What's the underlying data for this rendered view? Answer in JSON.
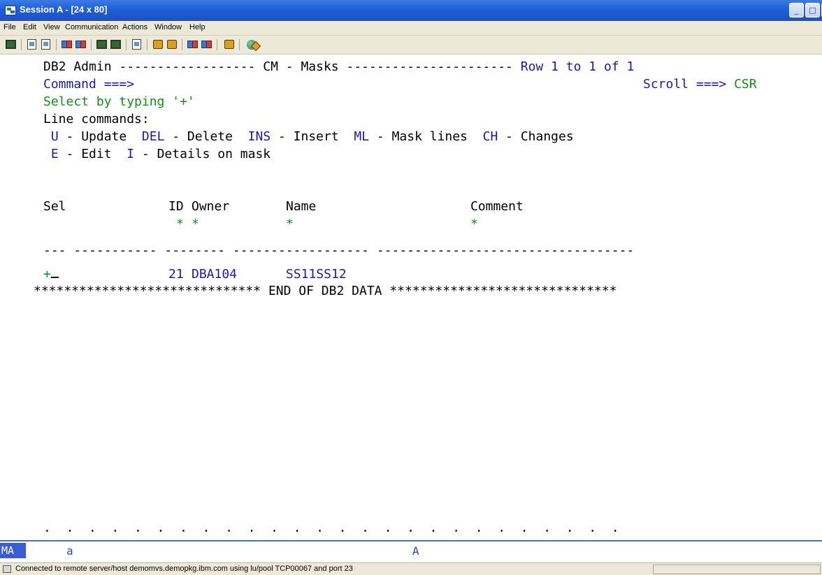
{
  "window": {
    "title": "Session A - [24 x 80]",
    "controls": {
      "minimize": "_",
      "maximize": "□",
      "close": "×"
    }
  },
  "menu": [
    {
      "label": "File"
    },
    {
      "label": "Edit"
    },
    {
      "label": "View"
    },
    {
      "label": "Communication"
    },
    {
      "label": "Actions"
    },
    {
      "label": "Window"
    },
    {
      "label": "Help"
    }
  ],
  "toolbar": {
    "icons": [
      "print-screen-icon",
      "copy-icon",
      "paste-icon",
      "send-file-icon",
      "receive-file-icon",
      "display-icon",
      "display-alt-icon",
      "keypad-icon",
      "record-macro-icon",
      "play-macro-icon",
      "stop-macro-icon",
      "macro-options-icon",
      "clipboard-icon",
      "globe-icon"
    ]
  },
  "terminal": {
    "header_left": "DB2 Admin ------------------ CM - Masks ----------------------",
    "header_right": "Row 1 to 1 of 1",
    "command_label": "Command ===>",
    "scroll_label": "Scroll ===>",
    "scroll_value": "CSR",
    "select_hint": "Select by typing '+'",
    "line_commands_label": "Line commands:",
    "line_commands_row1": [
      {
        "key": "U",
        "desc": " - Update  "
      },
      {
        "key": "DEL",
        "desc": " - Delete  "
      },
      {
        "key": "INS",
        "desc": " - Insert  "
      },
      {
        "key": "ML",
        "desc": " - Mask lines  "
      },
      {
        "key": "CH",
        "desc": " - Changes"
      }
    ],
    "line_commands_row2": [
      {
        "key": "E",
        "desc": " - Edit  "
      },
      {
        "key": "I",
        "desc": " - Details on mask"
      }
    ],
    "columns": {
      "sel": "Sel",
      "id": "ID",
      "owner": "Owner",
      "name": "Name",
      "comment": "Comment"
    },
    "filters": {
      "id": "*",
      "owner": "*",
      "name": "*",
      "comment": "*"
    },
    "separator": "--- ----------- -------- ------------------ ----------------------------------",
    "rows": [
      {
        "sel": "+",
        "id": "21",
        "owner": "DBA104",
        "name": "SS11SS12",
        "comment": ""
      }
    ],
    "end_line": "****************************** END OF DB2 DATA ******************************",
    "bottom_dots": ".  .  .  .  .  .  .  .  .  .  .  .  .  .  .  .  .  .  .  .  .  .  .  .  .  ."
  },
  "oia": {
    "mode": "MA",
    "indicator_a1": "a",
    "indicator_a2": "A"
  },
  "status": {
    "text": "Connected to remote server/host demomvs.demopkg.ibm.com using lu/pool TCP00067 and port 23"
  },
  "colors": {
    "terminal_blue": "#1a1aa8",
    "terminal_green": "#119111",
    "title_blue": "#1f5fd6"
  }
}
